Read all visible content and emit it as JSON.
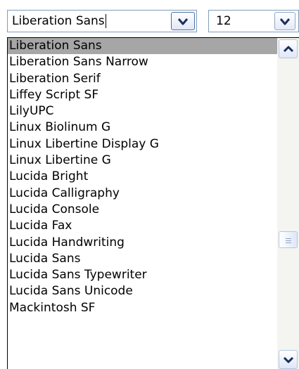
{
  "font_combo": {
    "value": "Liberation Sans",
    "dropdown_icon": "chevron-down-icon"
  },
  "size_combo": {
    "value": "12",
    "dropdown_icon": "chevron-down-icon"
  },
  "font_list": {
    "selected_index": 0,
    "items": [
      "Liberation Sans",
      "Liberation Sans Narrow",
      "Liberation Serif",
      "Liffey Script SF",
      "LilyUPC",
      "Linux Biolinum G",
      "Linux Libertine Display G",
      "Linux Libertine G",
      "Lucida Bright",
      "Lucida Calligraphy",
      "Lucida Console",
      "Lucida Fax",
      "Lucida Handwriting",
      "Lucida Sans",
      "Lucida Sans Typewriter",
      "Lucida Sans Unicode",
      "Mackintosh SF"
    ]
  },
  "scrollbar": {
    "up_icon": "chevron-up-icon",
    "down_icon": "chevron-down-icon",
    "thumb_icon": "grip-icon"
  }
}
